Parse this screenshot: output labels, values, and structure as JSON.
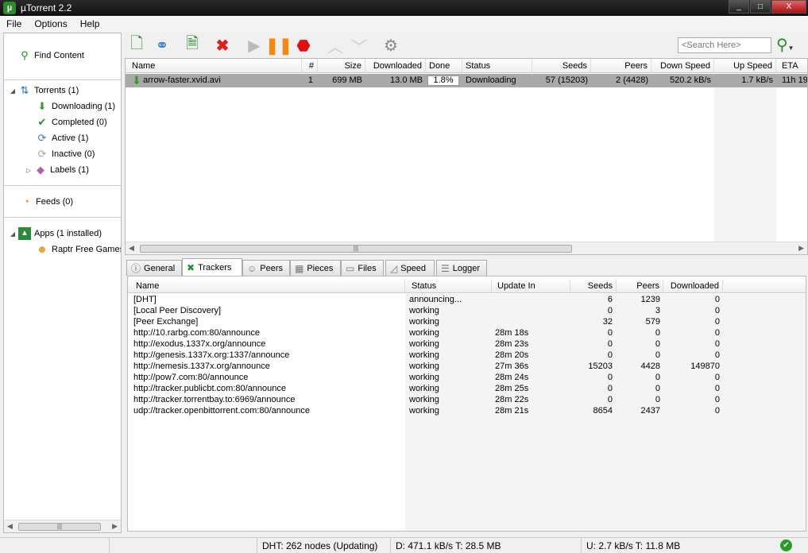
{
  "window": {
    "title": "µTorrent 2.2",
    "app_icon": "utorrent-logo-icon",
    "min": "_",
    "max": "□",
    "close": "X"
  },
  "menu": [
    "File",
    "Options",
    "Help"
  ],
  "sidebar": {
    "find": "Find Content",
    "torrents": "Torrents (1)",
    "downloading": "Downloading (1)",
    "completed": "Completed (0)",
    "active": "Active (1)",
    "inactive": "Inactive (0)",
    "labels": "Labels (1)",
    "feeds": "Feeds (0)",
    "apps": "Apps (1 installed)",
    "raptr": "Raptr Free Games"
  },
  "toolbar": {
    "search_placeholder": "<Search Here>"
  },
  "torrent_list": {
    "columns": [
      "Name",
      "#",
      "Size",
      "Downloaded",
      "Done",
      "Status",
      "Seeds",
      "Peers",
      "Down Speed",
      "Up Speed",
      "ETA"
    ],
    "rows": [
      {
        "name": "arrow-faster.xvid.avi",
        "num": "1",
        "size": "699 MB",
        "downloaded": "13.0 MB",
        "done": "1.8%",
        "status": "Downloading",
        "seeds": "57 (15203)",
        "peers": "2 (4428)",
        "down": "520.2 kB/s",
        "up": "1.7 kB/s",
        "eta": "11h 19"
      }
    ]
  },
  "tabs": [
    "General",
    "Trackers",
    "Peers",
    "Pieces",
    "Files",
    "Speed",
    "Logger"
  ],
  "trackers": {
    "columns": [
      "Name",
      "Status",
      "Update In",
      "Seeds",
      "Peers",
      "Downloaded"
    ],
    "rows": [
      {
        "name": "[DHT]",
        "status": "announcing...",
        "update": "",
        "seeds": "6",
        "peers": "1239",
        "downloaded": "0"
      },
      {
        "name": "[Local Peer Discovery]",
        "status": "working",
        "update": "",
        "seeds": "0",
        "peers": "3",
        "downloaded": "0"
      },
      {
        "name": "[Peer Exchange]",
        "status": "working",
        "update": "",
        "seeds": "32",
        "peers": "579",
        "downloaded": "0"
      },
      {
        "name": "http://10.rarbg.com:80/announce",
        "status": "working",
        "update": "28m 18s",
        "seeds": "0",
        "peers": "0",
        "downloaded": "0"
      },
      {
        "name": "http://exodus.1337x.org/announce",
        "status": "working",
        "update": "28m 23s",
        "seeds": "0",
        "peers": "0",
        "downloaded": "0"
      },
      {
        "name": "http://genesis.1337x.org:1337/announce",
        "status": "working",
        "update": "28m 20s",
        "seeds": "0",
        "peers": "0",
        "downloaded": "0"
      },
      {
        "name": "http://nemesis.1337x.org/announce",
        "status": "working",
        "update": "27m 36s",
        "seeds": "15203",
        "peers": "4428",
        "downloaded": "149870"
      },
      {
        "name": "http://pow7.com:80/announce",
        "status": "working",
        "update": "28m 24s",
        "seeds": "0",
        "peers": "0",
        "downloaded": "0"
      },
      {
        "name": "http://tracker.publicbt.com:80/announce",
        "status": "working",
        "update": "28m 25s",
        "seeds": "0",
        "peers": "0",
        "downloaded": "0"
      },
      {
        "name": "http://tracker.torrentbay.to:6969/announce",
        "status": "working",
        "update": "28m 22s",
        "seeds": "0",
        "peers": "0",
        "downloaded": "0"
      },
      {
        "name": "udp://tracker.openbittorrent.com:80/announce",
        "status": "working",
        "update": "28m 21s",
        "seeds": "8654",
        "peers": "2437",
        "downloaded": "0"
      }
    ]
  },
  "status": {
    "dht": "DHT: 262 nodes (Updating)",
    "down": "D: 471.1 kB/s T: 28.5 MB",
    "up": "U: 2.7 kB/s T: 11.8 MB"
  }
}
